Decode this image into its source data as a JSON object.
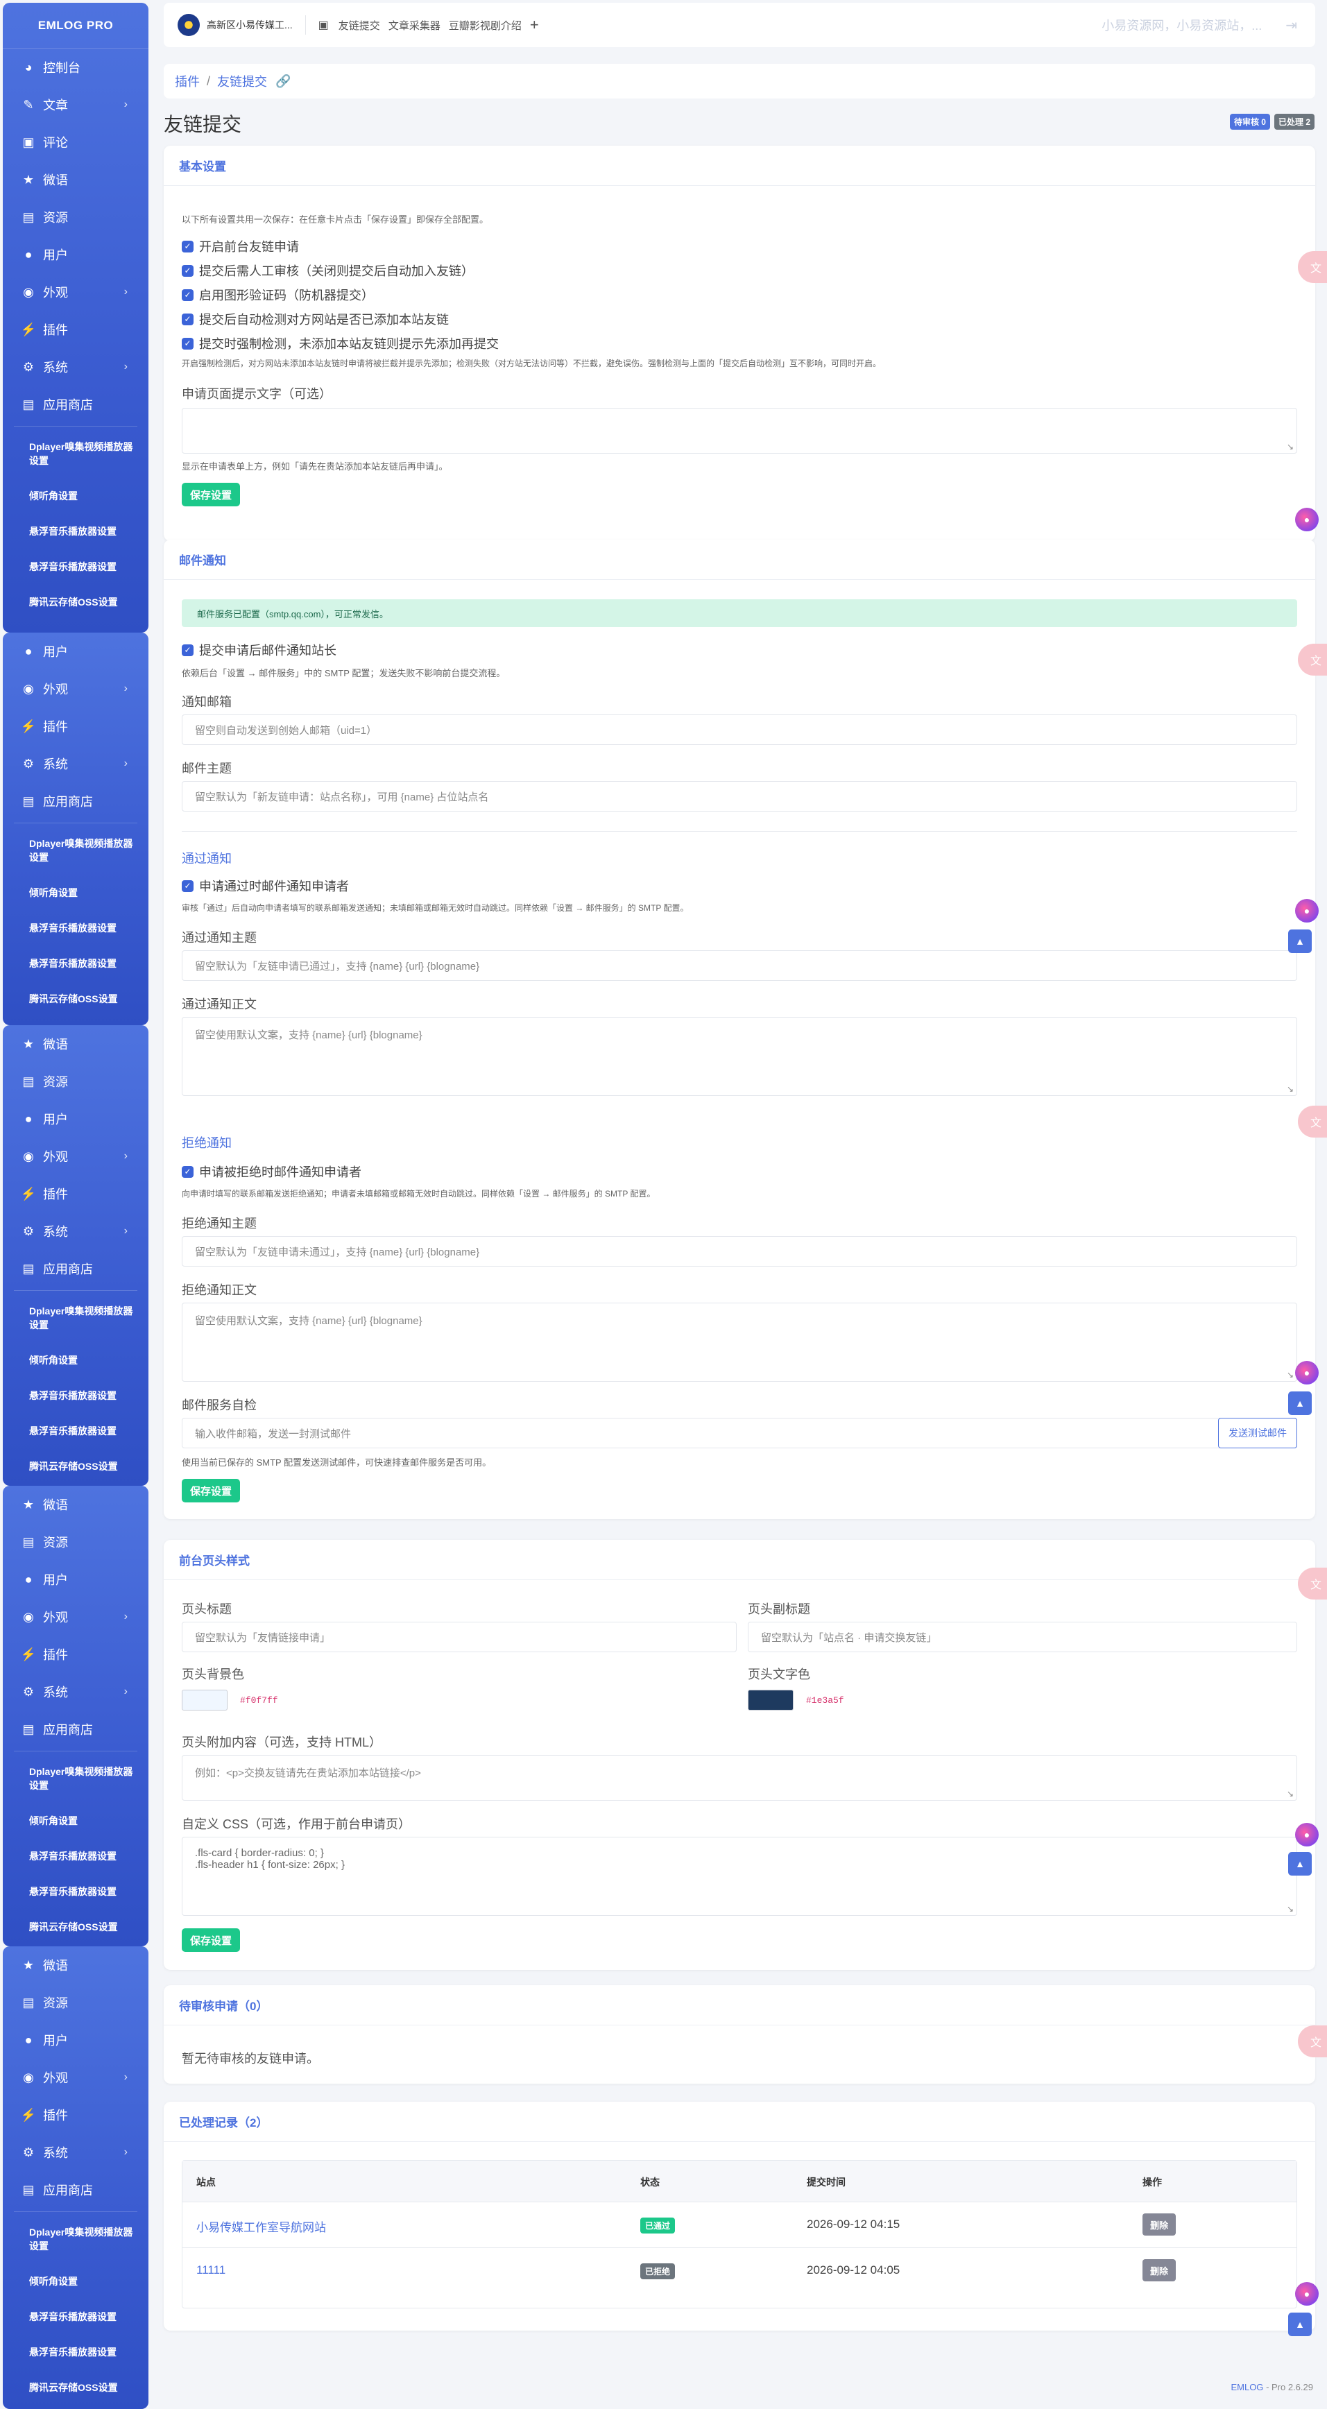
{
  "sidebar": {
    "brand": "EMLOG PRO",
    "items": [
      {
        "label": "控制台",
        "icon": "dashboard-icon"
      },
      {
        "label": "文章",
        "icon": "pen-icon",
        "chevron": true
      },
      {
        "label": "评论",
        "icon": "comment-icon"
      },
      {
        "label": "微语",
        "icon": "megaphone-icon"
      },
      {
        "label": "资源",
        "icon": "image-icon"
      },
      {
        "label": "用户",
        "icon": "user-icon"
      },
      {
        "label": "外观",
        "icon": "palette-icon",
        "chevron": true
      },
      {
        "label": "插件",
        "icon": "plug-icon"
      },
      {
        "label": "系统",
        "icon": "gear-icon",
        "chevron": true
      },
      {
        "label": "应用商店",
        "icon": "cart-icon"
      }
    ],
    "plugins": [
      "Dplayer嗅集视频播放器设置",
      "倾听角设置",
      "悬浮音乐播放器设置",
      "悬浮音乐播放器设置",
      "腾讯云存储OSS设置"
    ]
  },
  "topbar": {
    "site_name": "高新区小易传媒工...",
    "links": [
      "友链提交",
      "文章采集器",
      "豆瓣影视剧介绍"
    ],
    "add": "+",
    "right_text": "小易资源网，小易资源站，..."
  },
  "breadcrumb": {
    "root": "插件",
    "sep": "/",
    "current": "友链提交"
  },
  "page": {
    "title": "友链提交",
    "badges": [
      {
        "text": "待审核 0",
        "color": "#4e73df"
      },
      {
        "text": "已处理 2",
        "color": "#6c757d"
      }
    ]
  },
  "basic": {
    "title": "基本设置",
    "note": "以下所有设置共用一次保存：在任意卡片点击「保存设置」即保存全部配置。",
    "checks": [
      "开启前台友链申请",
      "提交后需人工审核（关闭则提交后自动加入友链）",
      "启用图形验证码（防机器提交）",
      "提交后自动检测对方网站是否已添加本站友链",
      "提交时强制检测，未添加本站友链则提示先添加再提交"
    ],
    "check_note": "开启强制检测后，对方网站未添加本站友链时申请将被拦截并提示先添加；检测失败（对方站无法访问等）不拦截，避免误伤。强制检测与上面的「提交后自动检测」互不影响，可同时开启。",
    "prompt_label": "申请页面提示文字（可选）",
    "prompt_help": "显示在申请表单上方，例如「请先在贵站添加本站友链后再申请」。",
    "save": "保存设置"
  },
  "mail": {
    "title": "邮件通知",
    "alert": "邮件服务已配置（smtp.qq.com），可正常发信。",
    "notify_owner": "提交申请后邮件通知站长",
    "notify_owner_note": "依赖后台「设置 → 邮件服务」中的 SMTP 配置；发送失败不影响前台提交流程。",
    "notify_email_label": "通知邮箱",
    "notify_email_ph": "留空则自动发送到创始人邮箱（uid=1）",
    "subject_label": "邮件主题",
    "subject_ph": "留空默认为「新友链申请：站点名称」，可用 {name} 占位站点名",
    "pass_title": "通过通知",
    "pass_check": "申请通过时邮件通知申请者",
    "pass_note": "审核「通过」后自动向申请者填写的联系邮箱发送通知；未填邮箱或邮箱无效时自动跳过。同样依赖「设置 → 邮件服务」的 SMTP 配置。",
    "pass_subject_label": "通过通知主题",
    "pass_subject_ph": "留空默认为「友链申请已通过」，支持 {name} {url} {blogname}",
    "pass_body_label": "通过通知正文",
    "pass_body_ph": "留空使用默认文案，支持 {name} {url} {blogname}",
    "reject_title": "拒绝通知",
    "reject_check": "申请被拒绝时邮件通知申请者",
    "reject_note": "向申请时填写的联系邮箱发送拒绝通知；申请者未填邮箱或邮箱无效时自动跳过。同样依赖「设置 → 邮件服务」的 SMTP 配置。",
    "reject_subject_label": "拒绝通知主题",
    "reject_subject_ph": "留空默认为「友链申请未通过」，支持 {name} {url} {blogname}",
    "reject_body_label": "拒绝通知正文",
    "reject_body_ph": "留空使用默认文案，支持 {name} {url} {blogname}",
    "test_label": "邮件服务自检",
    "test_ph": "输入收件邮箱，发送一封测试邮件",
    "test_btn": "发送测试邮件",
    "test_note": "使用当前已保存的 SMTP 配置发送测试邮件，可快速排查邮件服务是否可用。",
    "save": "保存设置"
  },
  "header_style": {
    "title": "前台页头样式",
    "page_title_label": "页头标题",
    "page_title_ph": "留空默认为「友情链接申请」",
    "subtitle_label": "页头副标题",
    "subtitle_ph": "留空默认为「站点名 · 申请交换友链」",
    "bg_label": "页头背景色",
    "bg_value": "#f0f7ff",
    "text_color_label": "页头文字色",
    "text_color_value": "#1e3a5f",
    "extra_label": "页头附加内容（可选，支持 HTML）",
    "extra_ph": "例如：<p>交换友链请先在贵站添加本站链接</p>",
    "css_label": "自定义 CSS（可选，作用于前台申请页）",
    "css_line1": ".fls-card { border-radius: 0; }",
    "css_line2": ".fls-header h1 { font-size: 26px; }",
    "save": "保存设置"
  },
  "pending": {
    "title": "待审核申请（0）",
    "empty": "暂无待审核的友链申请。"
  },
  "processed": {
    "title": "已处理记录（2）",
    "columns": [
      "站点",
      "状态",
      "提交时间",
      "操作"
    ],
    "rows": [
      {
        "site": "小易传媒工作室导航网站",
        "status": "已通过",
        "status_color": "#1cc88a",
        "time": "2026-09-12 04:15",
        "action": "删除"
      },
      {
        "site": "11111",
        "status": "已拒绝",
        "status_color": "#6c757d",
        "time": "2026-09-12 04:05",
        "action": "删除"
      }
    ]
  },
  "footer": {
    "brand": "EMLOG",
    "version": "- Pro 2.6.29"
  }
}
